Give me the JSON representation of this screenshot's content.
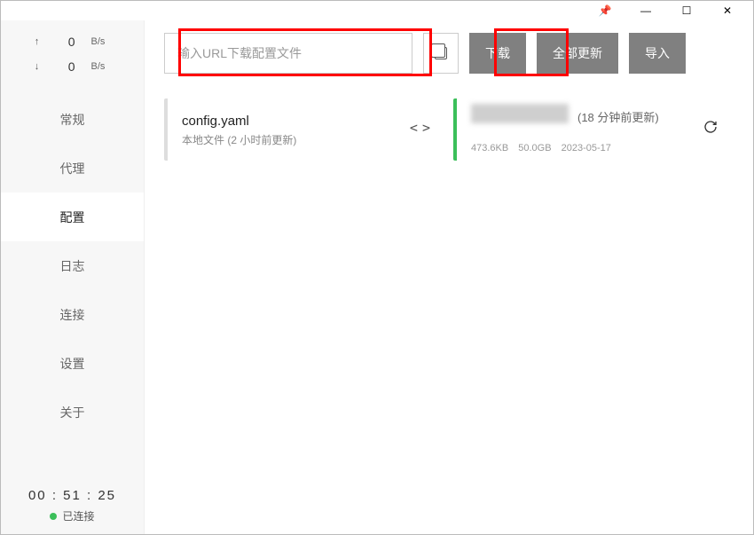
{
  "titlebar": {
    "pin": "📌",
    "minimize": "—",
    "maximize": "☐",
    "close": "✕"
  },
  "speed": {
    "up_arrow": "↑",
    "up_value": "0",
    "up_unit": "B/s",
    "down_arrow": "↓",
    "down_value": "0",
    "down_unit": "B/s"
  },
  "nav": {
    "general": "常规",
    "proxy": "代理",
    "config": "配置",
    "logs": "日志",
    "connections": "连接",
    "settings": "设置",
    "about": "关于"
  },
  "status": {
    "timer": "00 : 51 : 25",
    "connected": "已连接"
  },
  "toolbar": {
    "url_placeholder": "输入URL下载配置文件",
    "download": "下载",
    "update_all": "全部更新",
    "import": "导入"
  },
  "cards": {
    "local": {
      "title": "config.yaml",
      "subtitle": "本地文件 (2 小时前更新)",
      "action_icon": "< >"
    },
    "remote": {
      "updated": "(18 分钟前更新)",
      "size": "473.6KB",
      "quota": "50.0GB",
      "date": "2023-05-17"
    }
  }
}
